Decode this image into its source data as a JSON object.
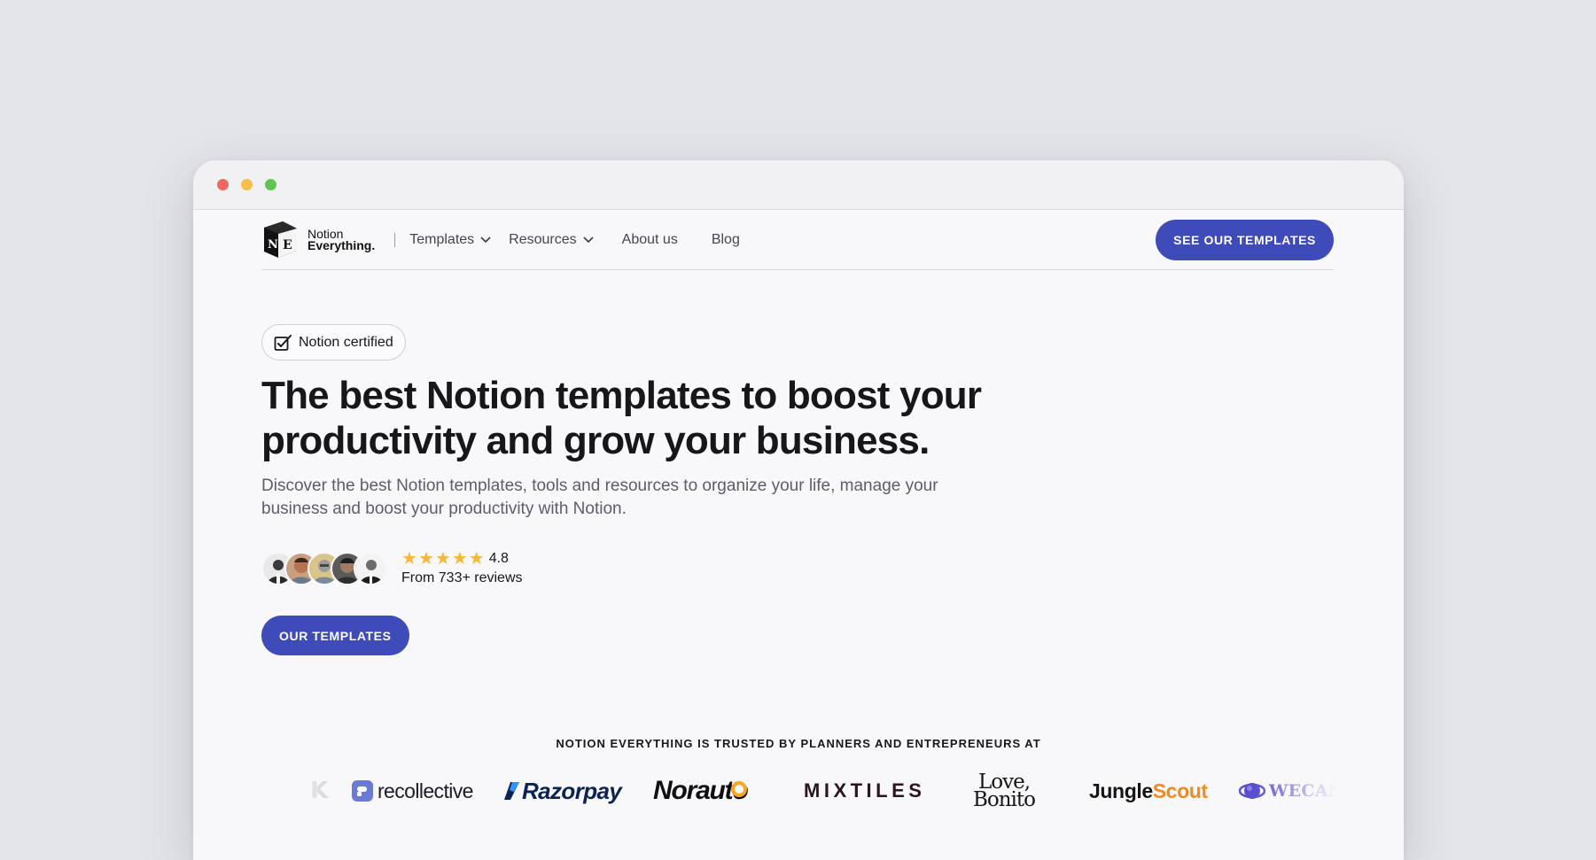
{
  "nav": {
    "logo_line1": "Notion",
    "logo_line2": "Everything.",
    "logo_glyph_n": "N",
    "logo_glyph_e": "E",
    "items": [
      {
        "label": "Templates",
        "dropdown": true
      },
      {
        "label": "Resources",
        "dropdown": true
      },
      {
        "label": "About us",
        "dropdown": false
      },
      {
        "label": "Blog",
        "dropdown": false
      }
    ],
    "cta_label": "SEE OUR TEMPLATES"
  },
  "hero": {
    "badge_label": "Notion certified",
    "headline": "The best Notion templates to boost your productivity and grow your business.",
    "subtext": "Discover the best Notion templates, tools and resources to organize your life, manage your business and boost your productivity with Notion.",
    "rating": "4.8",
    "star_count": 5,
    "reviews_label": "From 733+ reviews",
    "cta_label": "OUR TEMPLATES"
  },
  "trusted": {
    "heading": "NOTION EVERYTHING IS TRUSTED BY PLANNERS AND ENTREPRENEURS AT",
    "brands": {
      "partial_left": "K",
      "recollective": "recollective",
      "razorpay": "Razorpay",
      "norauto_main": "Norauto",
      "mixtiles": "MIXTILES",
      "love_bonito_1": "Love,",
      "love_bonito_2": "Bonito",
      "jungle": "Jungle",
      "scout": "Scout",
      "wecan": "WECANI"
    }
  },
  "colors": {
    "accent": "#3f4bb8",
    "star": "#f5b83a",
    "background": "#e4e5e9",
    "page": "#f8f8fa",
    "jungle_scout_orange": "#f08a24",
    "recollective_blue": "#6a7bd6",
    "wecan_purple": "#5a4fcf"
  }
}
